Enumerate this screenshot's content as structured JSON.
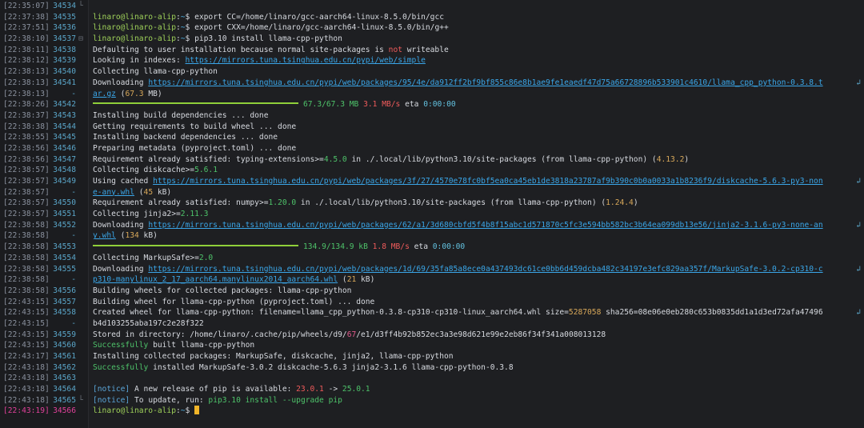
{
  "terminal": {
    "user_host": "linaro@linaro-alip",
    "path": "~",
    "colors": {
      "background": "#1e1f22",
      "prompt": "#9fd25a",
      "url": "#3aa6e8",
      "progress": "#8fcf3a",
      "cursor": "#f0b429",
      "current_line": "#e0409a"
    },
    "rows": [
      {
        "ts": "[22:35:07]",
        "ln": "34534",
        "fold": "└",
        "type": "blank"
      },
      {
        "ts": "[22:37:38]",
        "ln": "34535",
        "type": "prompt",
        "cmd": "export CC=/home/linaro/gcc-aarch64-linux-8.5.0/bin/gcc"
      },
      {
        "ts": "[22:37:51]",
        "ln": "34536",
        "type": "prompt",
        "cmd": "export CXX=/home/linaro/gcc-aarch64-linux-8.5.0/bin/g++"
      },
      {
        "ts": "[22:38:10]",
        "ln": "34537",
        "fold": "⊟",
        "type": "prompt",
        "cmd": "pip3.10 install llama-cpp-python"
      },
      {
        "ts": "[22:38:11]",
        "ln": "34538",
        "type": "defaulting",
        "a": "Defaulting to user installation because normal site-packages is ",
        "b": "not",
        "c": " writeable"
      },
      {
        "ts": "[22:38:12]",
        "ln": "34539",
        "type": "indexes",
        "a": "Looking in indexes: ",
        "url": "https://mirrors.tuna.tsinghua.edu.cn/pypi/web/simple"
      },
      {
        "ts": "[22:38:13]",
        "ln": "34540",
        "type": "plain",
        "text": "Collecting llama-cpp-python"
      },
      {
        "ts": "[22:38:13]",
        "ln": "34541",
        "type": "download",
        "a": "  Downloading ",
        "url": "https://mirrors.tuna.tsinghua.edu.cn/pypi/web/packages/95/4e/da912ff2bf9bf855c86e8b1ae9fe1eaedf47d75a66728896b533901c4610/llama_cpp_python-0.3.8.t",
        "wrap": "↲"
      },
      {
        "ts": "[22:38:13]",
        "ln": "-",
        "type": "wrapdl",
        "url": "ar.gz",
        "size": " (67.3 MB)"
      },
      {
        "ts": "[22:38:26]",
        "ln": "34542",
        "type": "progress",
        "done": "67.3/67.3 MB",
        "speed": "3.1 MB/s",
        "eta_label": " eta ",
        "eta": "0:00:00"
      },
      {
        "ts": "[22:38:37]",
        "ln": "34543",
        "type": "plain",
        "text": "  Installing build dependencies ... done"
      },
      {
        "ts": "[22:38:38]",
        "ln": "34544",
        "type": "plain",
        "text": "  Getting requirements to build wheel ... done"
      },
      {
        "ts": "[22:38:55]",
        "ln": "34545",
        "type": "plain",
        "text": "  Installing backend dependencies ... done"
      },
      {
        "ts": "[22:38:56]",
        "ln": "34546",
        "type": "plain",
        "text": "  Preparing metadata (pyproject.toml) ... done"
      },
      {
        "ts": "[22:38:56]",
        "ln": "34547",
        "type": "req",
        "a": "Requirement already satisfied: typing-extensions",
        "op": ">=",
        "ver": "4.5.0",
        "b": " in ./.local/lib/python3.10/site-packages (from llama-cpp-python) (",
        "v2": "4.13.2",
        "c": ")"
      },
      {
        "ts": "[22:38:57]",
        "ln": "34548",
        "type": "collect",
        "a": "Collecting diskcache",
        "op": ">=",
        "ver": "5.6.1"
      },
      {
        "ts": "[22:38:57]",
        "ln": "34549",
        "type": "cached",
        "a": "  Using cached ",
        "url": "https://mirrors.tuna.tsinghua.edu.cn/pypi/web/packages/3f/27/4570e78fc0bf5ea0ca45eb1de3818a23787af9b390c0b0a0033a1b8236f9/diskcache-5.6.3-py3-non",
        "wrap": "↲"
      },
      {
        "ts": "[22:38:57]",
        "ln": "-",
        "type": "wrapdl",
        "url": "e-any.whl",
        "size": " (45 kB)"
      },
      {
        "ts": "[22:38:57]",
        "ln": "34550",
        "type": "req",
        "a": "Requirement already satisfied: numpy",
        "op": ">=",
        "ver": "1.20.0",
        "b": " in ./.local/lib/python3.10/site-packages (from llama-cpp-python) (",
        "v2": "1.24.4",
        "c": ")"
      },
      {
        "ts": "[22:38:57]",
        "ln": "34551",
        "type": "collect",
        "a": "Collecting jinja2",
        "op": ">=",
        "ver": "2.11.3"
      },
      {
        "ts": "[22:38:58]",
        "ln": "34552",
        "type": "download",
        "a": "  Downloading ",
        "url": "https://mirrors.tuna.tsinghua.edu.cn/pypi/web/packages/62/a1/3d680cbfd5f4b8f15abc1d571870c5fc3e594bb582bc3b64ea099db13e56/jinja2-3.1.6-py3-none-an",
        "wrap": "↲"
      },
      {
        "ts": "[22:38:58]",
        "ln": "-",
        "type": "wrapdl",
        "url": "y.whl",
        "size": " (134 kB)"
      },
      {
        "ts": "[22:38:58]",
        "ln": "34553",
        "type": "progress",
        "done": "134.9/134.9 kB",
        "speed": "1.8 MB/s",
        "eta_label": " eta ",
        "eta": "0:00:00"
      },
      {
        "ts": "[22:38:58]",
        "ln": "34554",
        "type": "collect",
        "a": "Collecting MarkupSafe",
        "op": ">=",
        "ver": "2.0"
      },
      {
        "ts": "[22:38:58]",
        "ln": "34555",
        "type": "download",
        "a": "  Downloading ",
        "url": "https://mirrors.tuna.tsinghua.edu.cn/pypi/web/packages/1d/69/35fa85a8ece0a437493dc61ce0bb6d459dcba482c34197e3efc829aa357f/MarkupSafe-3.0.2-cp310-c",
        "wrap": "↲"
      },
      {
        "ts": "[22:38:58]",
        "ln": "-",
        "type": "wrapdl",
        "url": "p310-manylinux_2_17_aarch64.manylinux2014_aarch64.whl",
        "size": " (21 kB)"
      },
      {
        "ts": "[22:38:58]",
        "ln": "34556",
        "type": "plain",
        "text": "Building wheels for collected packages: llama-cpp-python"
      },
      {
        "ts": "[22:43:15]",
        "ln": "34557",
        "type": "plain",
        "text": "  Building wheel for llama-cpp-python (pyproject.toml) ... done"
      },
      {
        "ts": "[22:43:15]",
        "ln": "34558",
        "type": "created",
        "a": "  Created wheel for llama-cpp-python: filename=llama_cpp_python-0.3.8-cp310-cp310-linux_aarch64.whl size=",
        "size": "5287058",
        "b": " sha256=08e06e0eb280c653b0835dd1a1d3ed72afa47496",
        "wrap": "↲"
      },
      {
        "ts": "[22:43:15]",
        "ln": "-",
        "type": "plain",
        "text": "b4d103255aba197c2e28f322"
      },
      {
        "ts": "[22:43:15]",
        "ln": "34559",
        "type": "stored",
        "a": "  Stored in directory: /home/linaro/.cache/pip/wheels/d9/",
        "hl": "67",
        "b": "/e1/d3ff4b92b852ec3a3e98d621e99e2eb86f34f341a008013128"
      },
      {
        "ts": "[22:43:15]",
        "ln": "34560",
        "type": "success",
        "ok": "Successfully",
        "b": " built llama-cpp-python"
      },
      {
        "ts": "[22:43:17]",
        "ln": "34561",
        "type": "plain",
        "text": "Installing collected packages: MarkupSafe, diskcache, jinja2, llama-cpp-python"
      },
      {
        "ts": "[22:43:18]",
        "ln": "34562",
        "type": "success",
        "ok": "Successfully",
        "b": " installed MarkupSafe-3.0.2 diskcache-5.6.3 jinja2-3.1.6 llama-cpp-python-0.3.8"
      },
      {
        "ts": "[22:43:18]",
        "ln": "34563",
        "type": "blank"
      },
      {
        "ts": "[22:43:18]",
        "ln": "34564",
        "type": "notice1",
        "tag": "[notice]",
        "a": " A new release of pip is available: ",
        "old": "23.0.1",
        "arrow": " -> ",
        "new": "25.0.1"
      },
      {
        "ts": "[22:43:18]",
        "ln": "34565",
        "fold": "└",
        "type": "notice2",
        "tag": "[notice]",
        "a": " To update, run: ",
        "cmd": "pip3.10 install --upgrade pip"
      },
      {
        "ts": "[22:43:19]",
        "ln": "34566",
        "type": "cursor",
        "current": true
      }
    ]
  }
}
